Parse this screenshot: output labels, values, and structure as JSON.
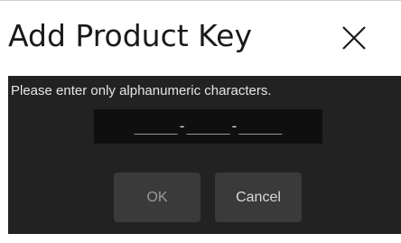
{
  "dialog": {
    "title": "Add Product Key",
    "close_icon": "close-icon"
  },
  "form": {
    "instructions": "Please enter only alphanumeric characters.",
    "key_value": "_____-_____-_____"
  },
  "buttons": {
    "ok_label": "OK",
    "cancel_label": "Cancel"
  },
  "colors": {
    "panel_background": "#222222",
    "field_background": "#0f0f0f",
    "button_background": "#3a3a3a",
    "text_light": "#e6e6e6"
  }
}
